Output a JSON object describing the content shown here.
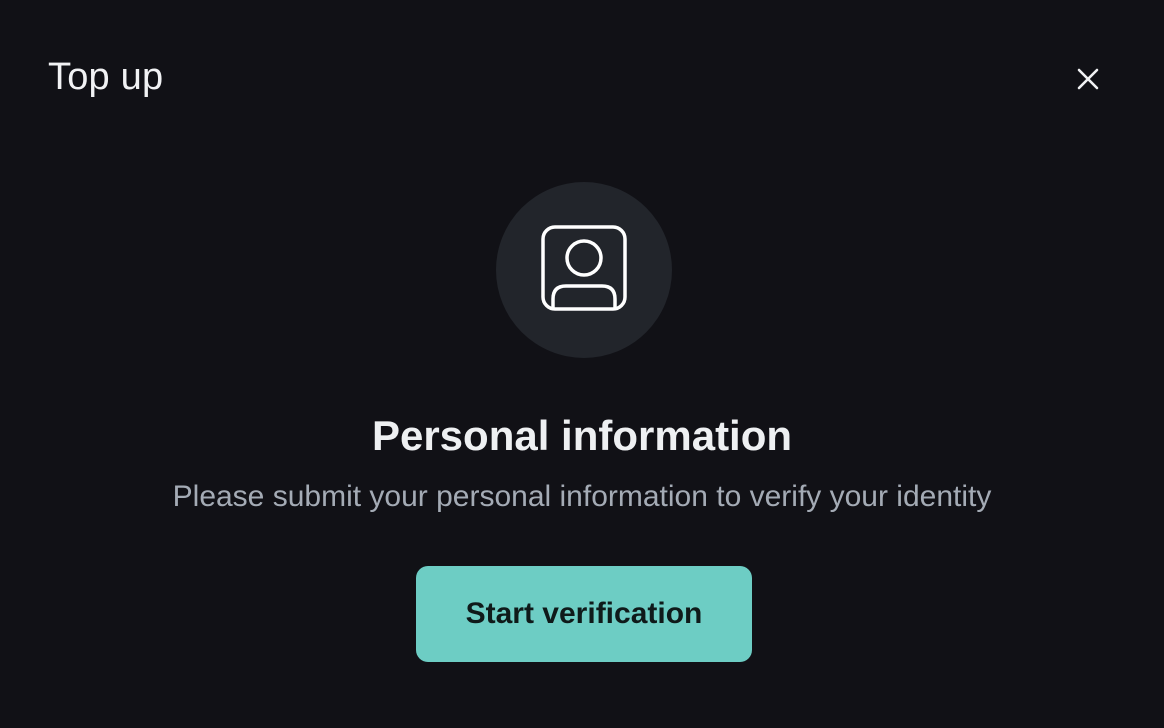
{
  "modal": {
    "title": "Top up",
    "close_icon": "close-icon"
  },
  "verification": {
    "icon": "user-profile-icon",
    "heading": "Personal information",
    "description": "Please submit your personal information to verify your identity",
    "button_label": "Start verification"
  },
  "colors": {
    "background": "#111116",
    "icon_circle": "#22252b",
    "accent": "#6dcdc4",
    "heading_text": "#eef0f2",
    "description_text": "#a4abb5"
  }
}
